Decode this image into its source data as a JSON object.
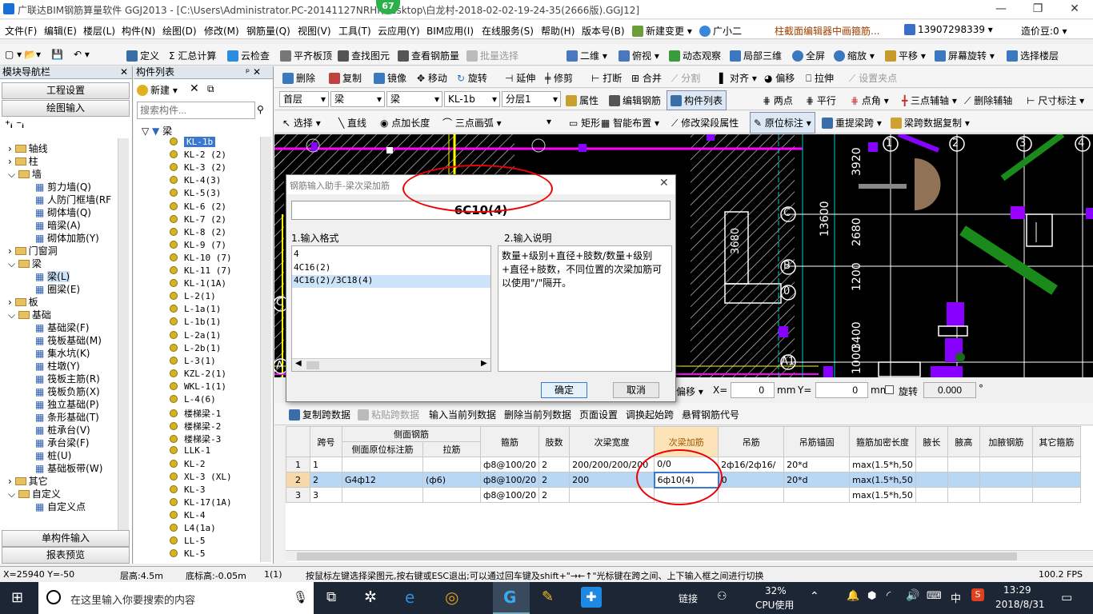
{
  "window": {
    "title": "广联达BIM钢筋算量软件 GGJ2013 - [C:\\Users\\Administrator.PC-20141127NRHI\\Desktop\\白龙村-2018-02-02-19-24-35(2666版).GGJ12]",
    "badge": "67"
  },
  "menu": [
    "文件(F)",
    "编辑(E)",
    "楼层(L)",
    "构件(N)",
    "绘图(D)",
    "修改(M)",
    "钢筋量(Q)",
    "视图(V)",
    "工具(T)",
    "云应用(Y)",
    "BIM应用(I)",
    "在线服务(S)",
    "帮助(H)",
    "版本号(B)",
    "新建变更",
    "广小二",
    "柱截面编辑器中画箍筋...",
    "13907298339",
    "造价豆:0"
  ],
  "toolbar1": [
    "定义",
    "Σ 汇总计算",
    "云检查",
    "平齐板顶",
    "查找图元",
    "查看钢筋量",
    "批量选择",
    "二维",
    "俯视",
    "动态观察",
    "局部三维",
    "全屏",
    "缩放",
    "平移",
    "屏幕旋转",
    "选择楼层"
  ],
  "left_nav": {
    "title": "模块导航栏",
    "btn_engineering": "工程设置",
    "btn_drawing": "绘图输入",
    "btn_single": "单构件输入",
    "btn_report": "报表预览",
    "tree": [
      {
        "label": "轴线",
        "level": 0,
        "kind": "folder"
      },
      {
        "label": "柱",
        "level": 0,
        "kind": "folder"
      },
      {
        "label": "墙",
        "level": 0,
        "kind": "folder",
        "open": true
      },
      {
        "label": "剪力墙(Q)",
        "level": 1
      },
      {
        "label": "人防门框墙(RF",
        "level": 1
      },
      {
        "label": "砌体墙(Q)",
        "level": 1
      },
      {
        "label": "暗梁(A)",
        "level": 1
      },
      {
        "label": "砌体加筋(Y)",
        "level": 1
      },
      {
        "label": "门窗洞",
        "level": 0,
        "kind": "folder"
      },
      {
        "label": "梁",
        "level": 0,
        "kind": "folder",
        "open": true
      },
      {
        "label": "梁(L)",
        "level": 1,
        "selected": true
      },
      {
        "label": "圈梁(E)",
        "level": 1
      },
      {
        "label": "板",
        "level": 0,
        "kind": "folder"
      },
      {
        "label": "基础",
        "level": 0,
        "kind": "folder",
        "open": true
      },
      {
        "label": "基础梁(F)",
        "level": 1
      },
      {
        "label": "筏板基础(M)",
        "level": 1
      },
      {
        "label": "集水坑(K)",
        "level": 1
      },
      {
        "label": "柱墩(Y)",
        "level": 1
      },
      {
        "label": "筏板主筋(R)",
        "level": 1
      },
      {
        "label": "筏板负筋(X)",
        "level": 1
      },
      {
        "label": "独立基础(P)",
        "level": 1
      },
      {
        "label": "条形基础(T)",
        "level": 1
      },
      {
        "label": "桩承台(V)",
        "level": 1
      },
      {
        "label": "承台梁(F)",
        "level": 1
      },
      {
        "label": "桩(U)",
        "level": 1
      },
      {
        "label": "基础板带(W)",
        "level": 1
      },
      {
        "label": "其它",
        "level": 0,
        "kind": "folder"
      },
      {
        "label": "自定义",
        "level": 0,
        "kind": "folder",
        "open": true
      },
      {
        "label": "自定义点",
        "level": 1
      }
    ]
  },
  "component_list": {
    "title": "构件列表",
    "new_btn": "新建",
    "search_placeholder": "搜索构件...",
    "root": "梁",
    "items": [
      "KL-1b",
      "KL-2 (2)",
      "KL-3 (2)",
      "KL-4(3)",
      "KL-5(3)",
      "KL-6 (2)",
      "KL-7 (2)",
      "KL-8 (2)",
      "KL-9 (7)",
      "KL-10 (7)",
      "KL-11 (7)",
      "KL-1(1A)",
      "L-2(1)",
      "L-1a(1)",
      "L-1b(1)",
      "L-2a(1)",
      "L-2b(1)",
      "L-3(1)",
      "KZL-2(1)",
      "WKL-1(1)",
      "L-4(6)",
      "楼梯梁-1",
      "楼梯梁-2",
      "楼梯梁-3",
      "LLK-1",
      "KL-2",
      "XL-3 (XL)",
      "KL-3",
      "KL-17(1A)",
      "KL-4",
      "L4(1a)",
      "LL-5",
      "KL-5"
    ]
  },
  "toolbar2": [
    "删除",
    "复制",
    "镜像",
    "移动",
    "旋转",
    "延伸",
    "修剪",
    "打断",
    "合并",
    "分割",
    "对齐",
    "偏移",
    "拉伸",
    "设置夹点"
  ],
  "toolbar3": {
    "floor": "首层",
    "type1": "梁",
    "type2": "梁",
    "component": "KL-1b",
    "layer": "分层1",
    "buttons": [
      "属性",
      "编辑钢筋",
      "构件列表",
      "两点",
      "平行",
      "点角",
      "三点辅轴",
      "删除辅轴",
      "尺寸标注"
    ]
  },
  "toolbar4": [
    "选择",
    "直线",
    "点加长度",
    "三点画弧",
    "矩形",
    "智能布置",
    "修改梁段属性",
    "原位标注",
    "重提梁跨",
    "梁跨数据复制"
  ],
  "cad_labels": {
    "axis_top": [
      "1",
      "2",
      "3",
      "4"
    ],
    "axis_right": [
      "C",
      "B",
      "0"
    ],
    "dims": [
      "3920",
      "13600",
      "2680",
      "1200",
      "3400",
      "1000",
      "3680"
    ],
    "left_marks": [
      "A",
      "C"
    ],
    "bottom_mark": "A1"
  },
  "dialog": {
    "title": "钢筋输入助手-梁次梁加筋",
    "input_value": "6C10(4)",
    "format_label": "1.输入格式",
    "desc_label": "2.输入说明",
    "formats": [
      "4",
      "4C16(2)",
      "4C16(2)/3C18(4)"
    ],
    "description": "数量+级别+直径+肢数/数量+级别+直径+肢数，不同位置的次梁加筋可以使用\"/\"隔开。",
    "ok": "确定",
    "cancel": "取消"
  },
  "coords": {
    "move_label": "偏移",
    "x_label": "X=",
    "x_value": "0",
    "y_label": "Y=",
    "y_value": "0",
    "unit": "mm",
    "rotate_label": "旋转",
    "rotate_value": "0.000",
    "deg": "°"
  },
  "grid_toolbar": [
    "复制跨数据",
    "粘贴跨数据",
    "输入当前列数据",
    "删除当前列数据",
    "页面设置",
    "调换起始跨",
    "悬臂钢筋代号"
  ],
  "grid": {
    "headers_top": [
      "",
      "跨号",
      "侧面钢筋",
      "",
      "箍筋",
      "肢数",
      "次梁宽度",
      "次梁加筋",
      "吊筋",
      "吊筋锚固",
      "箍筋加密长度",
      "腋长",
      "腋高",
      "加腋钢筋",
      "其它箍筋"
    ],
    "headers_sub": [
      "侧面原位标注筋",
      "拉筋"
    ],
    "rows": [
      [
        "1",
        "1",
        "",
        "",
        "ф8@100/20",
        "2",
        "200/200/200/200",
        "0/0",
        "2ф16/2ф16/",
        "20*d",
        "max(1.5*h,50",
        "",
        "",
        "",
        ""
      ],
      [
        "2",
        "2",
        "G4ф12",
        "(ф6)",
        "ф8@100/20",
        "2",
        "200",
        "6ф10(4)",
        "0",
        "20*d",
        "max(1.5*h,50",
        "",
        "",
        "",
        ""
      ],
      [
        "3",
        "3",
        "",
        "",
        "ф8@100/20",
        "2",
        "",
        "",
        "",
        "",
        "max(1.5*h,50",
        "",
        "",
        "",
        ""
      ]
    ]
  },
  "status": {
    "coords": "X=25940 Y=-50",
    "floor_height": "层高:4.5m",
    "bottom_height": "底标高:-0.05m",
    "count": "1(1)",
    "hint": "按鼠标左键选择梁图元,按右键或ESC退出;可以通过回车键及shift+\"→←↑\"光标键在跨之间、上下输入框之间进行切换",
    "fps": "100.2 FPS"
  },
  "taskbar": {
    "search_placeholder": "在这里输入你要搜索的内容",
    "link_label": "链接",
    "cpu_pct": "32%",
    "cpu_label": "CPU使用",
    "ime": "中",
    "time": "13:29",
    "date": "2018/8/31"
  }
}
